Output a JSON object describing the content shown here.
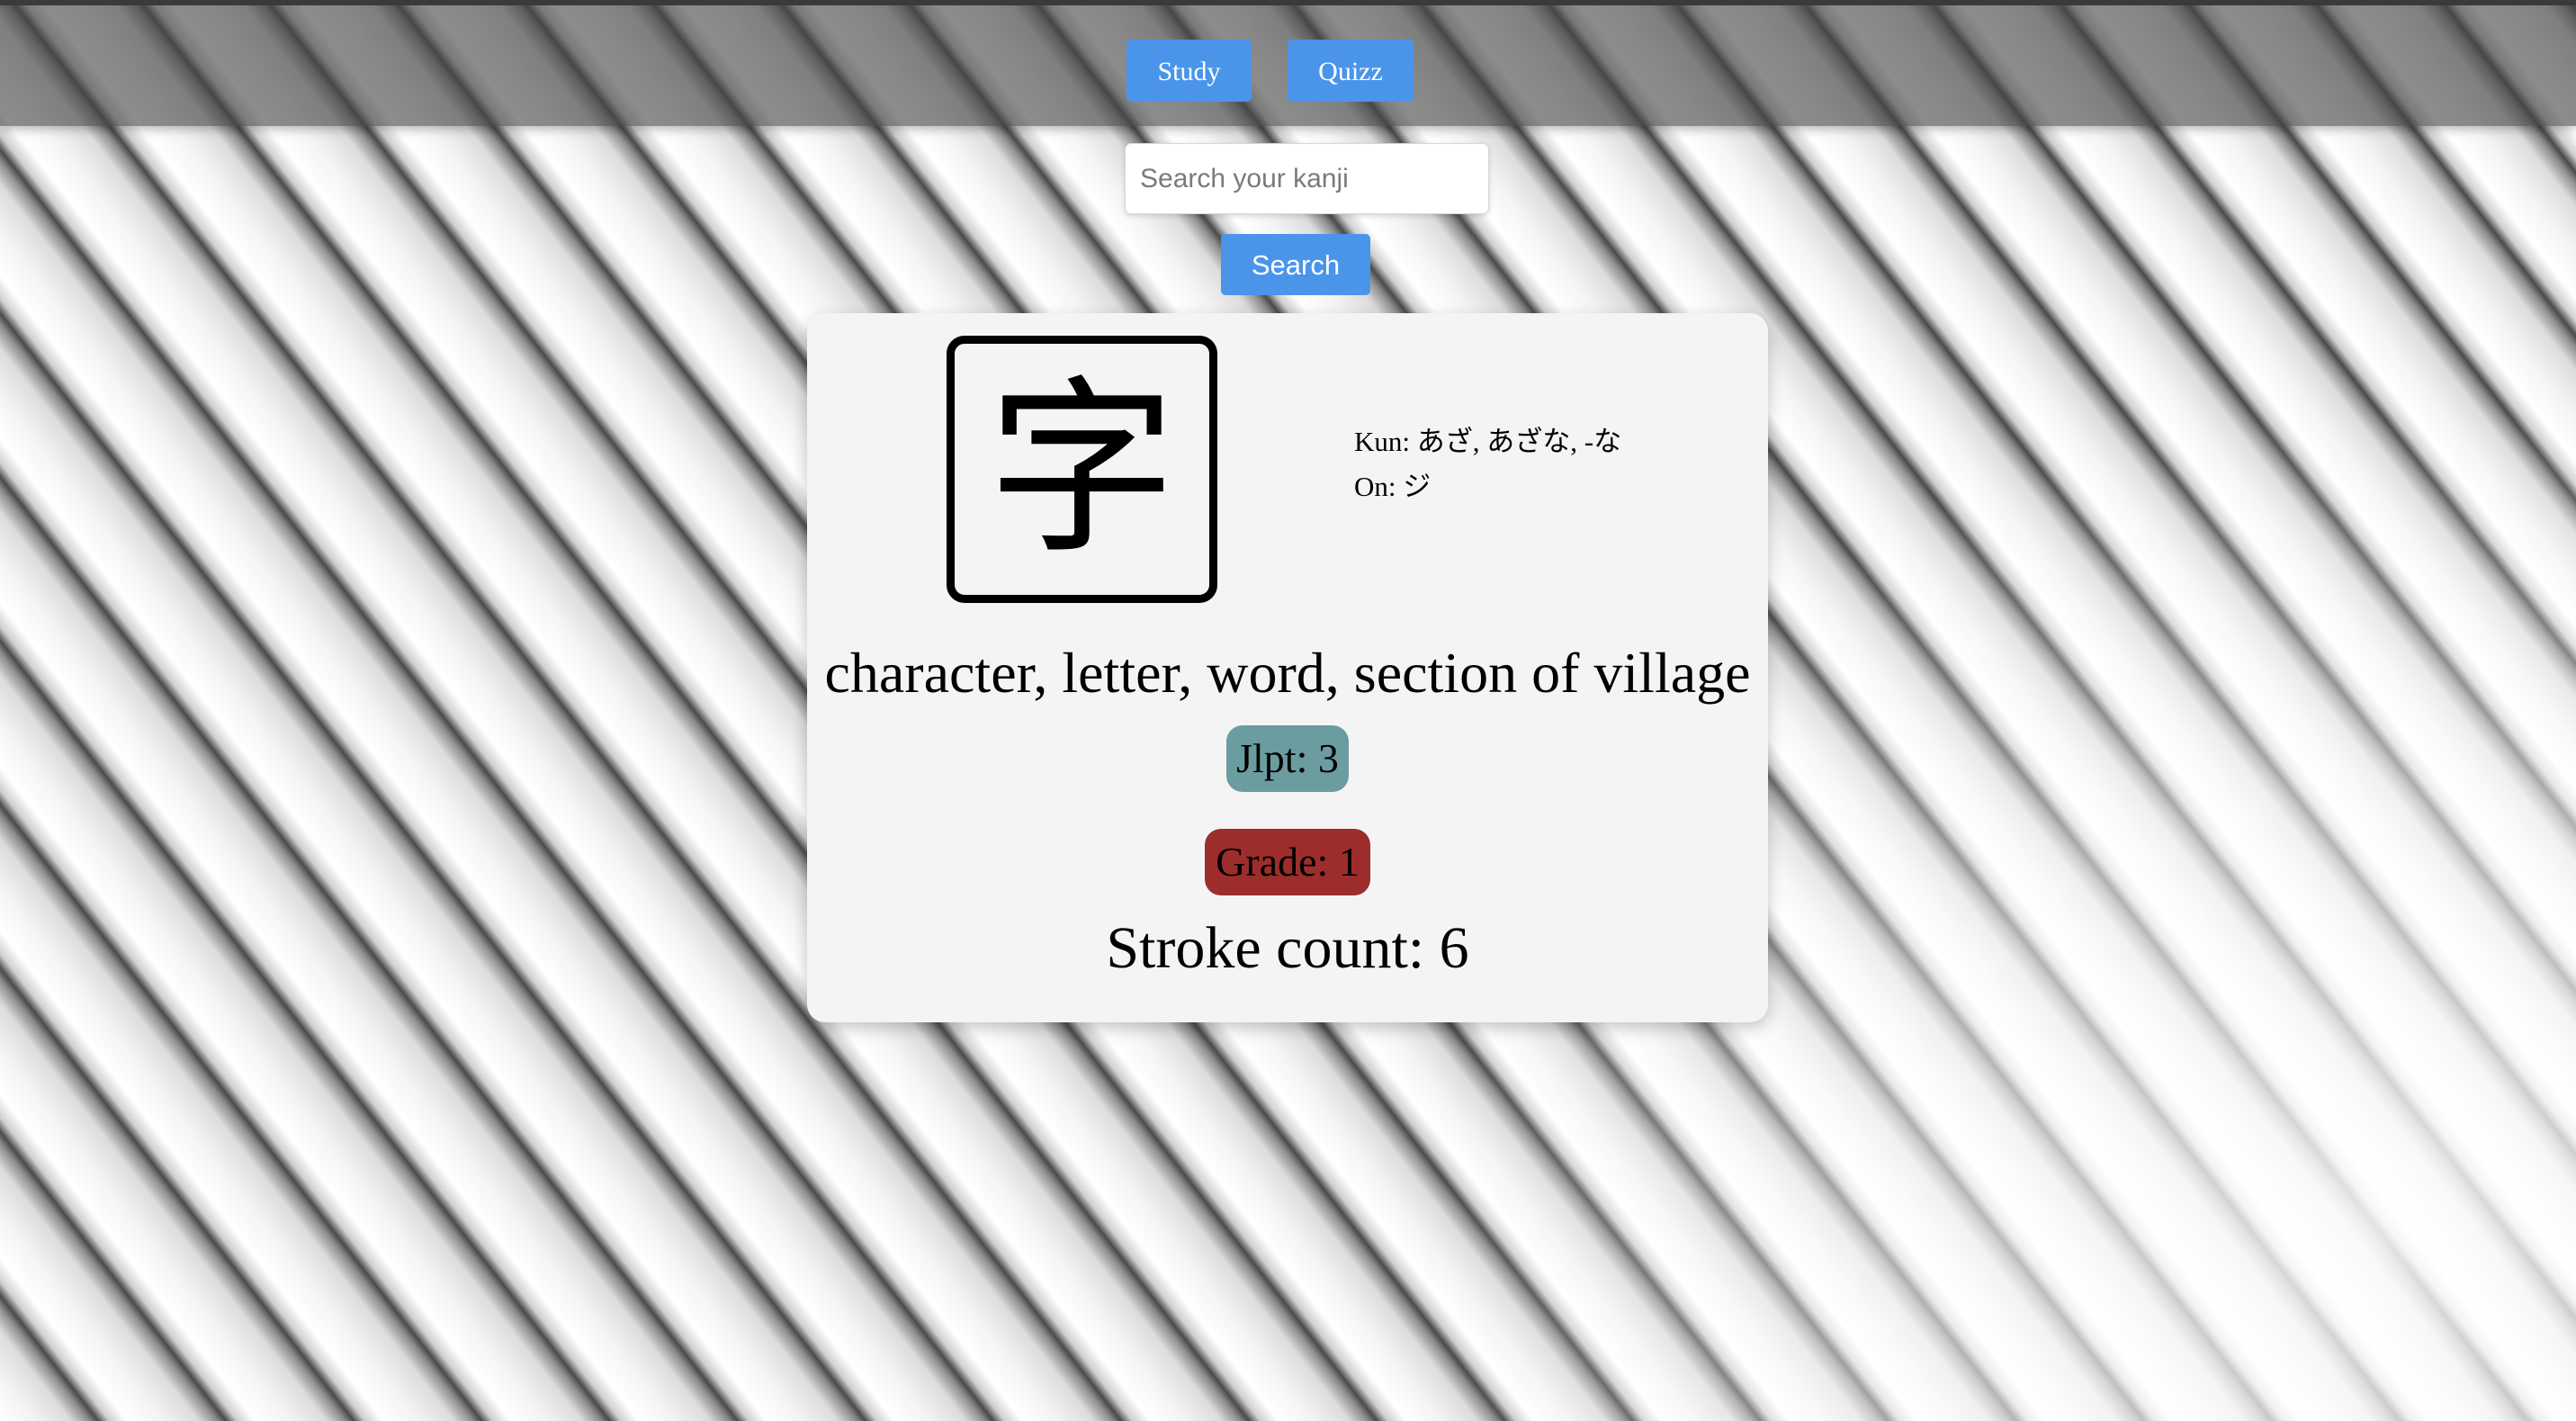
{
  "nav": {
    "study_label": "Study",
    "quizz_label": "Quizz"
  },
  "search": {
    "placeholder": "Search your kanji",
    "value": "",
    "button_label": "Search"
  },
  "kanji_card": {
    "character": "字",
    "kun_label": "Kun:",
    "kun_value": "あざ, あざな, -な",
    "on_label": "On:",
    "on_value": "ジ",
    "meaning": "character, letter, word, section of village",
    "jlpt_label": "Jlpt:",
    "jlpt_value": "3",
    "grade_label": "Grade:",
    "grade_value": "1",
    "stroke_label": "Stroke count:",
    "stroke_value": "6"
  },
  "colors": {
    "button_blue": "#4a95ea",
    "jlpt_badge": "#6b9ca0",
    "grade_badge": "#9c2d2b",
    "card_background": "#f4f4f4"
  }
}
